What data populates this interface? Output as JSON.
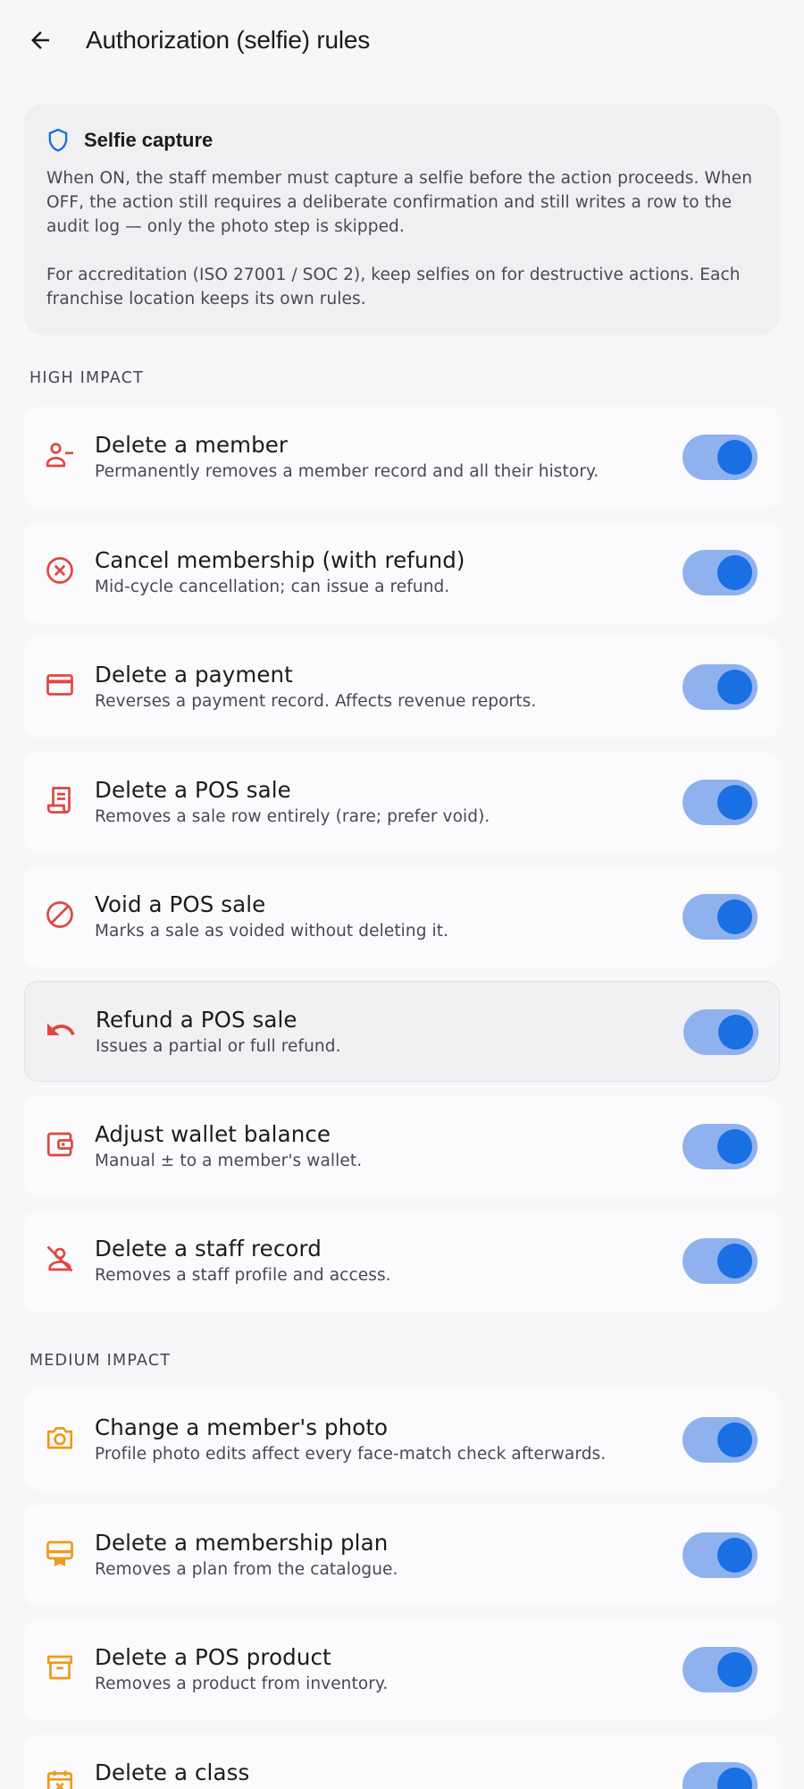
{
  "appbar": {
    "title": "Authorization (selfie) rules",
    "back_icon": "arrow-left-icon"
  },
  "info": {
    "icon": "shield-icon",
    "title": "Selfie capture",
    "paragraph1": "When ON, the staff member must capture a selfie before the action proceeds. When OFF, the action still requires a deliberate confirmation and still writes a row to the audit log — only the photo step is skipped.",
    "paragraph2": "For accreditation (ISO 27001 / SOC 2), keep selfies on for destructive actions. Each franchise location keeps its own rules."
  },
  "colors": {
    "high_impact": "#e0473f",
    "medium_impact": "#ee9a1a",
    "toggle_track_on": "#8fb2ef",
    "toggle_thumb_on": "#1a6fe3",
    "info_icon": "#1a6fe3"
  },
  "sections": {
    "high": {
      "label": "HIGH IMPACT",
      "rules": [
        {
          "title": "Delete a member",
          "desc": "Permanently removes a member record and all their history.",
          "icon": "person-remove-icon",
          "on": true
        },
        {
          "title": "Cancel membership (with refund)",
          "desc": "Mid-cycle cancellation; can issue a refund.",
          "icon": "cancel-circle-icon",
          "on": true
        },
        {
          "title": "Delete a payment",
          "desc": "Reverses a payment record. Affects revenue reports.",
          "icon": "credit-card-icon",
          "on": true
        },
        {
          "title": "Delete a POS sale",
          "desc": "Removes a sale row entirely (rare; prefer void).",
          "icon": "receipt-icon",
          "on": true
        },
        {
          "title": "Void a POS sale",
          "desc": "Marks a sale as voided without deleting it.",
          "icon": "block-icon",
          "on": true
        },
        {
          "title": "Refund a POS sale",
          "desc": "Issues a partial or full refund.",
          "icon": "undo-icon",
          "on": true
        },
        {
          "title": "Adjust wallet balance",
          "desc": "Manual ± to a member's wallet.",
          "icon": "wallet-icon",
          "on": true
        },
        {
          "title": "Delete a staff record",
          "desc": "Removes a staff profile and access.",
          "icon": "person-off-icon",
          "on": true
        }
      ]
    },
    "medium": {
      "label": "MEDIUM IMPACT",
      "rules": [
        {
          "title": "Change a member's photo",
          "desc": "Profile photo edits affect every face-match check afterwards.",
          "icon": "camera-icon",
          "on": true
        },
        {
          "title": "Delete a membership plan",
          "desc": "Removes a plan from the catalogue.",
          "icon": "card-membership-icon",
          "on": true
        },
        {
          "title": "Delete a POS product",
          "desc": "Removes a product from inventory.",
          "icon": "inventory-box-icon",
          "on": true
        },
        {
          "title": "Delete a class",
          "desc": "",
          "icon": "event-busy-icon",
          "on": true
        }
      ]
    }
  }
}
